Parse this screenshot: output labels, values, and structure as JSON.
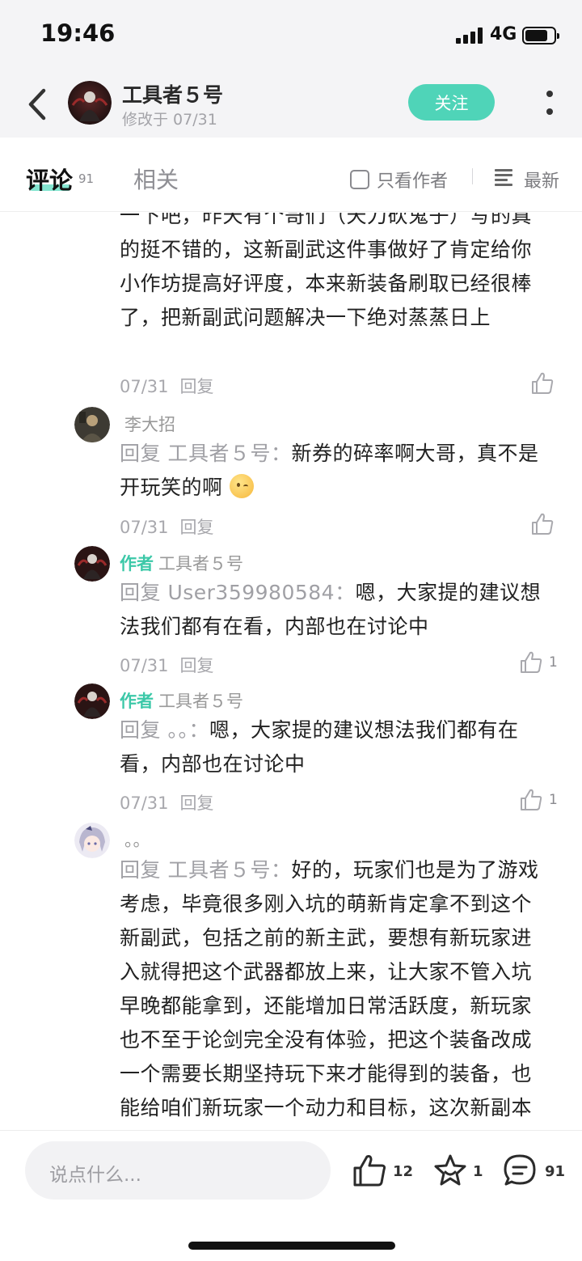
{
  "status_bar": {
    "time": "19:46",
    "network": "4G",
    "battery_level": 0.8
  },
  "nav": {
    "name": "工具者５号",
    "subtitle": "修改于 07/31",
    "follow_label": "关注"
  },
  "tabs": {
    "comments_label": "评论",
    "comments_count": "91",
    "related_label": "相关",
    "author_only_label": "只看作者",
    "sort_label": "最新"
  },
  "thread": [
    {
      "id": "c0",
      "avatar": "none",
      "name": "",
      "author_tag": "",
      "reply_prefix": "",
      "text": "一下吧，昨天有个哥们（天刀砍鬼子）写的真的挺不错的，这新副武这件事做好了肯定给你小作坊提高好评度，本来新装备刷取已经很棒了，把新副武问题解决一下绝对蒸蒸日上",
      "date": "07/31",
      "reply_label": "回复",
      "likes": ""
    },
    {
      "id": "c1",
      "avatar": "dark-portrait",
      "name": "李大招",
      "author_tag": "",
      "reply_prefix": "回复 工具者５号：",
      "text": "新券的碎率啊大哥，真不是开玩笑的啊",
      "date": "07/31",
      "reply_label": "回复",
      "likes": ""
    },
    {
      "id": "c2",
      "avatar": "author-avatar",
      "name": "工具者５号",
      "author_tag": "作者",
      "reply_prefix": "回复 User359980584：",
      "text": "嗯，大家提的建议想法我们都有在看，内部也在讨论中",
      "date": "07/31",
      "reply_label": "回复",
      "likes": "1"
    },
    {
      "id": "c3",
      "avatar": "author-avatar",
      "name": "工具者５号",
      "author_tag": "作者",
      "reply_prefix": "回复 。。：",
      "text": "嗯，大家提的建议想法我们都有在看，内部也在讨论中",
      "date": "07/31",
      "reply_label": "回复",
      "likes": "1"
    },
    {
      "id": "c4",
      "avatar": "anime-avatar",
      "name": "。。",
      "author_tag": "",
      "reply_prefix": "回复 工具者５号：",
      "text": "好的，玩家们也是为了游戏考虑，毕竟很多刚入坑的萌新肯定拿不到这个新副武，包括之前的新主武，要想有新玩家进入就得把这个武器都放上来，让大家不管入坑早晚都能拿到，还能增加日常活跃度，新玩家也不至于论剑完全没有体验，把这个装备改成一个需要长期坚持玩下来才能得到的装备，也能给咱们新玩家一个动力和目标，这次新副本刷取装备就做的很棒，很",
      "date": "",
      "reply_label": "",
      "likes": ""
    }
  ],
  "bottom_bar": {
    "input_placeholder": "说点什么...",
    "like_count": "12",
    "fav_count": "1",
    "comment_count": "91"
  },
  "colors": {
    "accent": "#4fd4b8",
    "author_tag": "#3cc8a8",
    "muted": "#a0a0a5"
  },
  "icons": [
    "back-arrow-icon",
    "more-vertical-icon",
    "checkbox-icon",
    "sort-lines-icon",
    "thumbs-up-icon",
    "star-icon",
    "comment-bubble-icon",
    "emoji-icon"
  ]
}
